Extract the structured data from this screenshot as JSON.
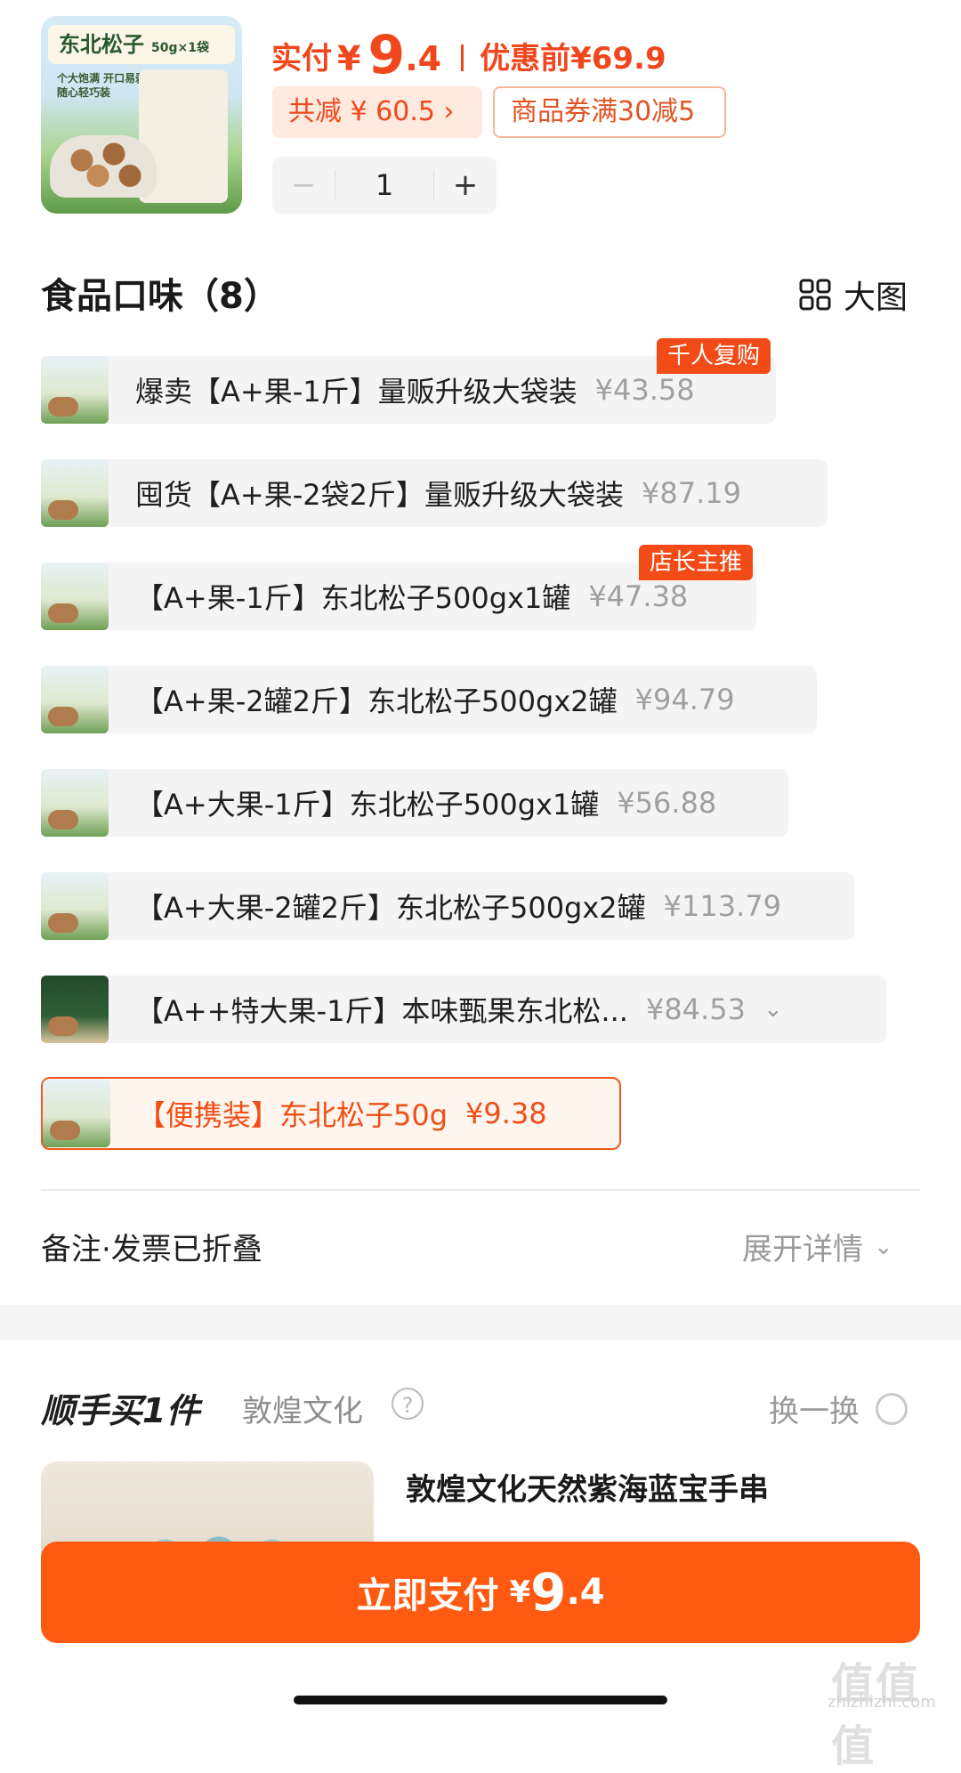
{
  "product": {
    "thumb_title": "东北松子",
    "thumb_spec": "50g×1袋",
    "thumb_sub": "个大饱满 开口易剥\n随心轻巧装",
    "paid_label": "实付",
    "currency": "¥",
    "paid_int": "9",
    "paid_dec": ".4",
    "orig_label": "优惠前",
    "orig_price": "¥69.9",
    "save_chip": "共减 ¥ 60.5 ›",
    "coupon_chip": "商品券满30减5",
    "minus": "−",
    "qty": "1",
    "plus": "+"
  },
  "flavor": {
    "title": "食品口味（8）",
    "big_view": "大图",
    "options": [
      {
        "label": "爆卖【A+果-1斤】量贩升级大袋装",
        "price": "¥43.58",
        "badge": "千人复购"
      },
      {
        "label": "囤货【A+果-2袋2斤】量贩升级大袋装",
        "price": "¥87.19"
      },
      {
        "label": "【A+果-1斤】东北松子500gx1罐",
        "price": "¥47.38",
        "badge": "店长主推"
      },
      {
        "label": "【A+果-2罐2斤】东北松子500gx2罐",
        "price": "¥94.79"
      },
      {
        "label": "【A+大果-1斤】东北松子500gx1罐",
        "price": "¥56.88"
      },
      {
        "label": "【A+大果-2罐2斤】东北松子500gx2罐",
        "price": "¥113.79"
      },
      {
        "label": "【A++特大果-1斤】本味甄果东北松...",
        "price": "¥84.53",
        "chevron": "⌄"
      },
      {
        "label": "【便携装】东北松子50g",
        "price": "¥9.38",
        "selected": true
      }
    ]
  },
  "remark": {
    "label": "备注·发票已折叠",
    "expand": "展开详情",
    "chevron": "⌄"
  },
  "addon": {
    "title": "顺手买1件",
    "shop": "敦煌文化",
    "help": "?",
    "refresh": "换一换",
    "item_title": "敦煌文化天然紫海蓝宝手串"
  },
  "pay": {
    "label": "立即支付",
    "currency": "¥",
    "int": "9",
    "dec": ".4"
  },
  "watermark": {
    "logo": "值值值",
    "url": "zhizhizhi.com"
  },
  "colors": {
    "accent": "#f0471c",
    "pay_button": "#ff5a12",
    "badge": "#f24b17"
  }
}
